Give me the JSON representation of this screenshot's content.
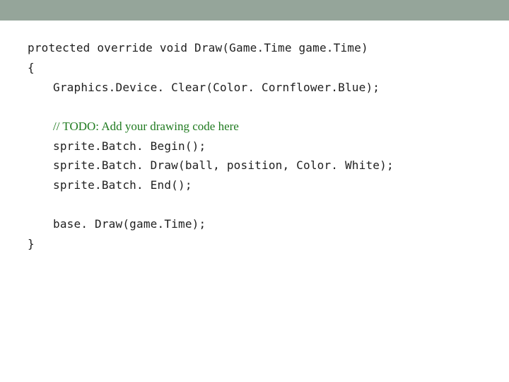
{
  "slide": {
    "accent_bar_color": "#95a59a"
  },
  "code": {
    "lines": [
      "protected override void Draw(Game.Time game.Time)",
      "{",
      "Graphics.Device. Clear(Color. Cornflower.Blue);",
      "// TODO: Add your drawing code here",
      "sprite.Batch. Begin();",
      "sprite.Batch. Draw(ball, position, Color. White);",
      "sprite.Batch. End();",
      "base. Draw(game.Time);",
      "}"
    ],
    "comment_color": "#1f7a1f"
  }
}
